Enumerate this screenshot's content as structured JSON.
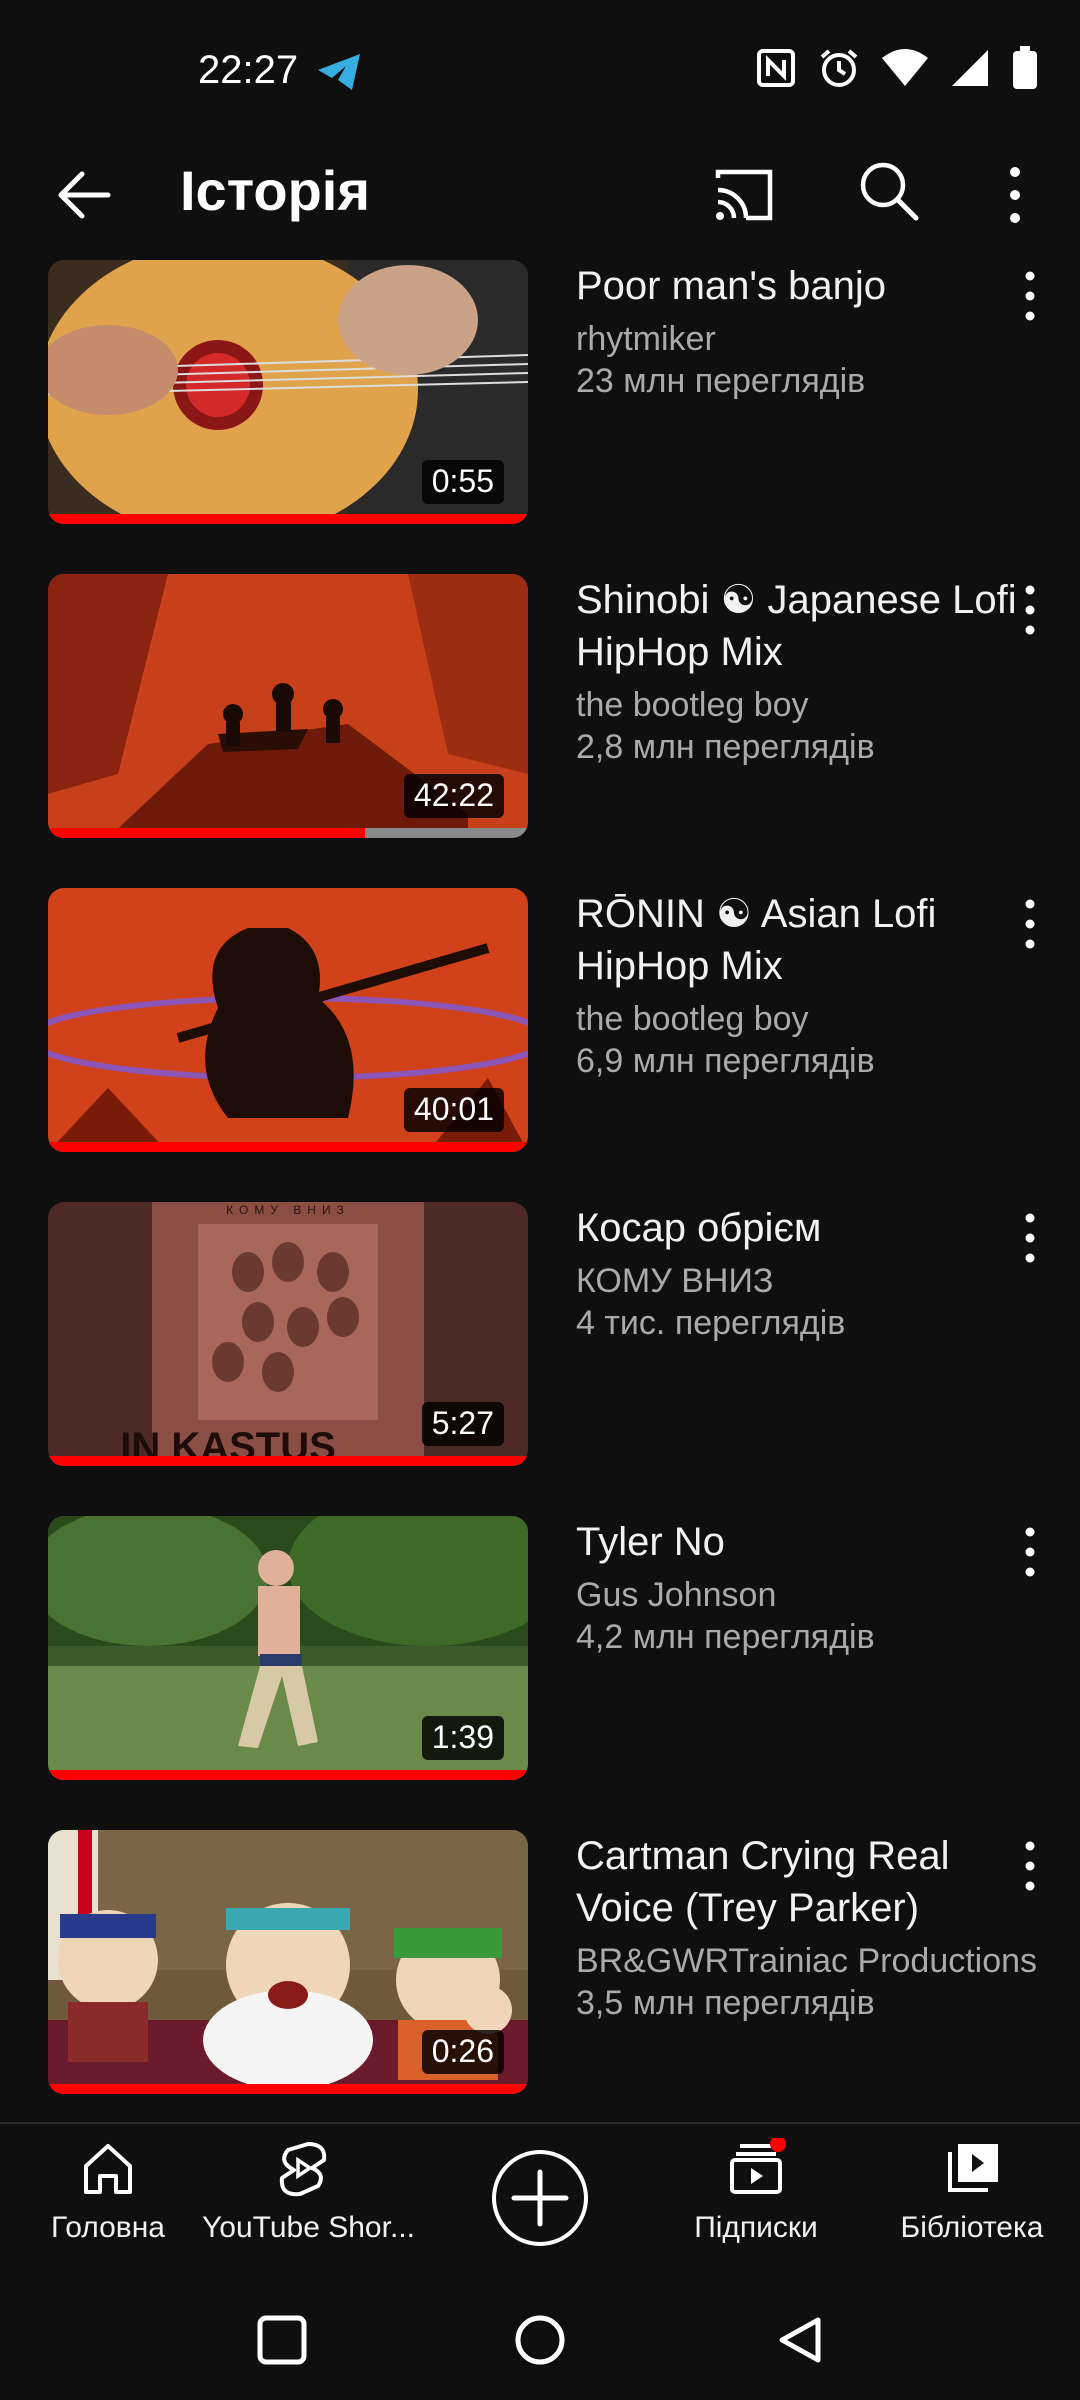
{
  "status_bar": {
    "time": "22:27"
  },
  "app_bar": {
    "title": "Історія"
  },
  "videos": [
    {
      "title": "Poor man's banjo",
      "channel": "rhytmiker",
      "views": "23 млн переглядів",
      "duration": "0:55",
      "progress": 1.0
    },
    {
      "title": "Shinobi ☯ Japanese Lofi HipHop Mix",
      "channel": "the bootleg boy",
      "views": "2,8 млн переглядів",
      "duration": "42:22",
      "progress": 0.66
    },
    {
      "title": "RŌNIN ☯ Asian Lofi HipHop Mix",
      "channel": "the bootleg boy",
      "views": "6,9 млн переглядів",
      "duration": "40:01",
      "progress": 1.0
    },
    {
      "title": "Косар обрієм",
      "channel": "КОМУ ВНИЗ",
      "views": "4 тис. переглядів",
      "duration": "5:27",
      "progress": 1.0,
      "thumb_text": {
        "band": "КОМУ ВНИЗ",
        "album": "IN KASTUS"
      }
    },
    {
      "title": "Tyler No",
      "channel": "Gus Johnson",
      "views": "4,2 млн переглядів",
      "duration": "1:39",
      "progress": 1.0
    },
    {
      "title": "Cartman Crying Real Voice (Trey Parker)",
      "channel": "BR&GWRTrainiac Productions",
      "views": "3,5 млн переглядів",
      "duration": "0:26",
      "progress": 1.0
    }
  ],
  "bottom_nav": {
    "home": "Головна",
    "shorts": "YouTube Shor...",
    "subscriptions": "Підписки",
    "library": "Бібліотека"
  },
  "colors": {
    "background": "#0f0f0f",
    "accent": "#ff0000",
    "secondary_text": "#aaaaaa"
  }
}
